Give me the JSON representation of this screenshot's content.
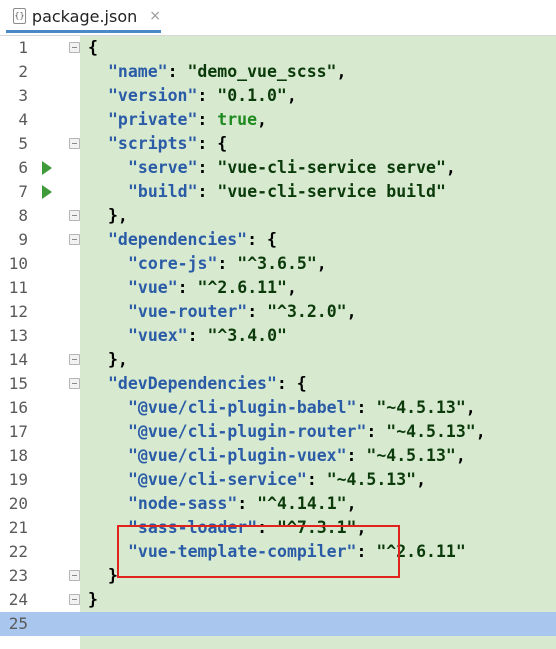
{
  "tab": {
    "filename": "package.json",
    "file_icon": "json-file-icon",
    "close_glyph": "×"
  },
  "colors": {
    "code_background": "#d7e9cf",
    "current_line": "#a9c7ee",
    "key": "#2a5ba6",
    "string": "#0a3a0a",
    "boolean": "#1f8a1f",
    "highlight_box": "#e0231c",
    "run_icon": "#3f9a3a"
  },
  "editor": {
    "current_line": 25,
    "highlighted_lines": [
      20,
      21
    ],
    "lines": [
      {
        "n": "1",
        "indent": 0,
        "parts": [
          {
            "t": "p",
            "v": "{"
          }
        ],
        "fold": true
      },
      {
        "n": "2",
        "indent": 1,
        "parts": [
          {
            "t": "k",
            "v": "\"name\""
          },
          {
            "t": "p",
            "v": ": "
          },
          {
            "t": "s",
            "v": "\"demo_vue_scss\""
          },
          {
            "t": "p",
            "v": ","
          }
        ]
      },
      {
        "n": "3",
        "indent": 1,
        "parts": [
          {
            "t": "k",
            "v": "\"version\""
          },
          {
            "t": "p",
            "v": ": "
          },
          {
            "t": "s",
            "v": "\"0.1.0\""
          },
          {
            "t": "p",
            "v": ","
          }
        ]
      },
      {
        "n": "4",
        "indent": 1,
        "parts": [
          {
            "t": "k",
            "v": "\"private\""
          },
          {
            "t": "p",
            "v": ": "
          },
          {
            "t": "b",
            "v": "true"
          },
          {
            "t": "p",
            "v": ","
          }
        ]
      },
      {
        "n": "5",
        "indent": 1,
        "parts": [
          {
            "t": "k",
            "v": "\"scripts\""
          },
          {
            "t": "p",
            "v": ": {"
          }
        ],
        "fold": true
      },
      {
        "n": "6",
        "indent": 2,
        "parts": [
          {
            "t": "k",
            "v": "\"serve\""
          },
          {
            "t": "p",
            "v": ": "
          },
          {
            "t": "s",
            "v": "\"vue-cli-service serve\""
          },
          {
            "t": "p",
            "v": ","
          }
        ],
        "run": true
      },
      {
        "n": "7",
        "indent": 2,
        "parts": [
          {
            "t": "k",
            "v": "\"build\""
          },
          {
            "t": "p",
            "v": ": "
          },
          {
            "t": "s",
            "v": "\"vue-cli-service build\""
          }
        ],
        "run": true
      },
      {
        "n": "8",
        "indent": 1,
        "parts": [
          {
            "t": "p",
            "v": "},"
          }
        ],
        "fold": true
      },
      {
        "n": "9",
        "indent": 1,
        "parts": [
          {
            "t": "k",
            "v": "\"dependencies\""
          },
          {
            "t": "p",
            "v": ": {"
          }
        ],
        "fold": true
      },
      {
        "n": "10",
        "indent": 2,
        "parts": [
          {
            "t": "k",
            "v": "\"core-js\""
          },
          {
            "t": "p",
            "v": ": "
          },
          {
            "t": "s",
            "v": "\"^3.6.5\""
          },
          {
            "t": "p",
            "v": ","
          }
        ]
      },
      {
        "n": "11",
        "indent": 2,
        "parts": [
          {
            "t": "k",
            "v": "\"vue\""
          },
          {
            "t": "p",
            "v": ": "
          },
          {
            "t": "s",
            "v": "\"^2.6.11\""
          },
          {
            "t": "p",
            "v": ","
          }
        ]
      },
      {
        "n": "12",
        "indent": 2,
        "parts": [
          {
            "t": "k",
            "v": "\"vue-router\""
          },
          {
            "t": "p",
            "v": ": "
          },
          {
            "t": "s",
            "v": "\"^3.2.0\""
          },
          {
            "t": "p",
            "v": ","
          }
        ]
      },
      {
        "n": "13",
        "indent": 2,
        "parts": [
          {
            "t": "k",
            "v": "\"vuex\""
          },
          {
            "t": "p",
            "v": ": "
          },
          {
            "t": "s",
            "v": "\"^3.4.0\""
          }
        ]
      },
      {
        "n": "14",
        "indent": 1,
        "parts": [
          {
            "t": "p",
            "v": "},"
          }
        ],
        "fold": true
      },
      {
        "n": "15",
        "indent": 1,
        "parts": [
          {
            "t": "k",
            "v": "\"devDependencies\""
          },
          {
            "t": "p",
            "v": ": {"
          }
        ],
        "fold": true
      },
      {
        "n": "16",
        "indent": 2,
        "parts": [
          {
            "t": "k",
            "v": "\"@vue/cli-plugin-babel\""
          },
          {
            "t": "p",
            "v": ": "
          },
          {
            "t": "s",
            "v": "\"~4.5.13\""
          },
          {
            "t": "p",
            "v": ","
          }
        ]
      },
      {
        "n": "17",
        "indent": 2,
        "parts": [
          {
            "t": "k",
            "v": "\"@vue/cli-plugin-router\""
          },
          {
            "t": "p",
            "v": ": "
          },
          {
            "t": "s",
            "v": "\"~4.5.13\""
          },
          {
            "t": "p",
            "v": ","
          }
        ]
      },
      {
        "n": "18",
        "indent": 2,
        "parts": [
          {
            "t": "k",
            "v": "\"@vue/cli-plugin-vuex\""
          },
          {
            "t": "p",
            "v": ": "
          },
          {
            "t": "s",
            "v": "\"~4.5.13\""
          },
          {
            "t": "p",
            "v": ","
          }
        ]
      },
      {
        "n": "19",
        "indent": 2,
        "parts": [
          {
            "t": "k",
            "v": "\"@vue/cli-service\""
          },
          {
            "t": "p",
            "v": ": "
          },
          {
            "t": "s",
            "v": "\"~4.5.13\""
          },
          {
            "t": "p",
            "v": ","
          }
        ]
      },
      {
        "n": "20",
        "indent": 2,
        "parts": [
          {
            "t": "k",
            "v": "\"node-sass\""
          },
          {
            "t": "p",
            "v": ": "
          },
          {
            "t": "s",
            "v": "\"^4.14.1\""
          },
          {
            "t": "p",
            "v": ","
          }
        ]
      },
      {
        "n": "21",
        "indent": 2,
        "parts": [
          {
            "t": "k",
            "v": "\"sass-loader\""
          },
          {
            "t": "p",
            "v": ": "
          },
          {
            "t": "s",
            "v": "\"^7.3.1\""
          },
          {
            "t": "p",
            "v": ","
          }
        ]
      },
      {
        "n": "22",
        "indent": 2,
        "parts": [
          {
            "t": "k",
            "v": "\"vue-template-compiler\""
          },
          {
            "t": "p",
            "v": ": "
          },
          {
            "t": "s",
            "v": "\"^2.6.11\""
          }
        ]
      },
      {
        "n": "23",
        "indent": 1,
        "parts": [
          {
            "t": "p",
            "v": "}"
          }
        ],
        "fold": true
      },
      {
        "n": "24",
        "indent": 0,
        "parts": [
          {
            "t": "p",
            "v": "}"
          }
        ],
        "fold": true
      },
      {
        "n": "25",
        "indent": 0,
        "parts": []
      }
    ]
  }
}
